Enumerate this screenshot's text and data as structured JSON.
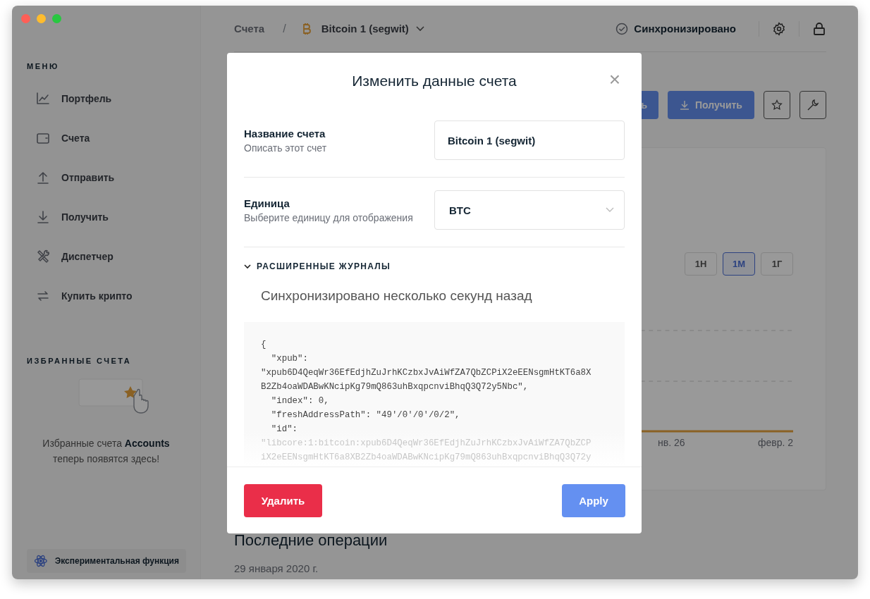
{
  "window": {
    "controls": [
      {
        "color": "#ff5f57"
      },
      {
        "color": "#febc2e"
      },
      {
        "color": "#28c840"
      }
    ]
  },
  "sidebar": {
    "menu_heading": "МЕНЮ",
    "items": [
      {
        "label": "Портфель",
        "selected": false
      },
      {
        "label": "Счета",
        "selected": false
      },
      {
        "label": "Отправить",
        "selected": false
      },
      {
        "label": "Получить",
        "selected": false
      },
      {
        "label": "Диспетчер",
        "selected": false
      },
      {
        "label": "Купить крипто",
        "selected": false
      }
    ],
    "favorites_heading": "ИЗБРАННЫЕ СЧЕТА",
    "favorites_empty": "Избранные счета **Accounts** теперь появятся здесь!",
    "experimental": "Экспериментальная функция"
  },
  "topbar": {
    "breadcrumb_root": "Счета",
    "breadcrumb_separator": "/",
    "account": "Bitcoin 1 (segwit)",
    "sync_status": "Синхронизировано"
  },
  "actions": {
    "send_visible_part": "ь",
    "receive": "Получить"
  },
  "card": {
    "ranges": [
      {
        "label": "1Н",
        "selected": false
      },
      {
        "label": "1М",
        "selected": true
      },
      {
        "label": "1Г",
        "selected": false
      }
    ],
    "x_labels": [
      "нв. 26",
      "февр. 2"
    ]
  },
  "operations": {
    "heading": "Последние операции",
    "date": "29 января 2020 г."
  },
  "modal": {
    "title": "Изменить данные счета",
    "close": "×",
    "fields": [
      {
        "kind": "text",
        "label": "Название счета",
        "hint": "Описать этот счет",
        "value": "Bitcoin 1 (segwit)"
      },
      {
        "kind": "select",
        "label": "Единица",
        "hint": "Выберите единицу для отображения",
        "value": "BTC"
      }
    ],
    "advanced": {
      "label": "РАСШИРЕННЫЕ ЖУРНАЛЫ",
      "expanded": true,
      "status": "Синхронизировано несколько секунд назад",
      "code": [
        "{",
        "  \"xpub\":",
        "\"xpub6D4QeqWr36EfEdjhZuJrhKCzbxJvAiWfZA7QbZCPiX2eEENsgmHtKT6a8X",
        "B2Zb4oaWDABwKNcipKg79mQ863uhBxqpcnviBhqQ3Q72y5Nbc\",",
        "  \"index\": 0,",
        "  \"freshAddressPath\": \"49'/0'/0'/0/2\",",
        "  \"id\":",
        "\"libcore:1:bitcoin:xpub6D4QeqWr36EfEdjhZuJrhKCzbxJvAiWfZA7QbZCP",
        "iX2eEENsgmHtKT6a8XB2Zb4oaWDABwKNcipKg79mQ863uhBxqpcnviBhqQ3Q72y"
      ]
    },
    "delete": "Удалить",
    "apply": "Apply"
  }
}
